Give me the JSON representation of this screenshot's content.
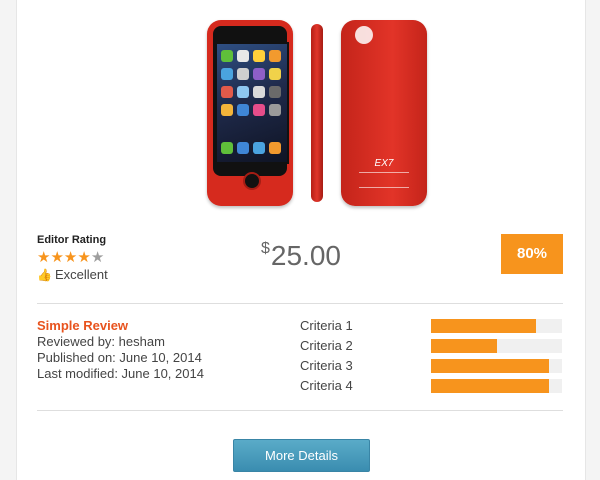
{
  "product": {
    "image_alt": "Red battery case for phone",
    "case_logo": "EX7"
  },
  "rating": {
    "label": "Editor Rating",
    "stars_filled": 4,
    "stars_total": 5,
    "verdict": "Excellent"
  },
  "price": {
    "currency": "$",
    "amount": "25.00"
  },
  "score": "80%",
  "review": {
    "title": "Simple Review",
    "reviewed_by": "Reviewed by: hesham",
    "published": "Published on: June 10, 2014",
    "modified": "Last modified: June 10, 2014"
  },
  "criteria": [
    {
      "label": "Criteria 1",
      "value": 0.8
    },
    {
      "label": "Criteria 2",
      "value": 0.5
    },
    {
      "label": "Criteria 3",
      "value": 0.9
    },
    {
      "label": "Criteria 4",
      "value": 0.9
    }
  ],
  "actions": {
    "more_details": "More Details"
  },
  "colors": {
    "accent": "#f7941d",
    "title": "#e8531e",
    "button": "#4a9dbe"
  }
}
